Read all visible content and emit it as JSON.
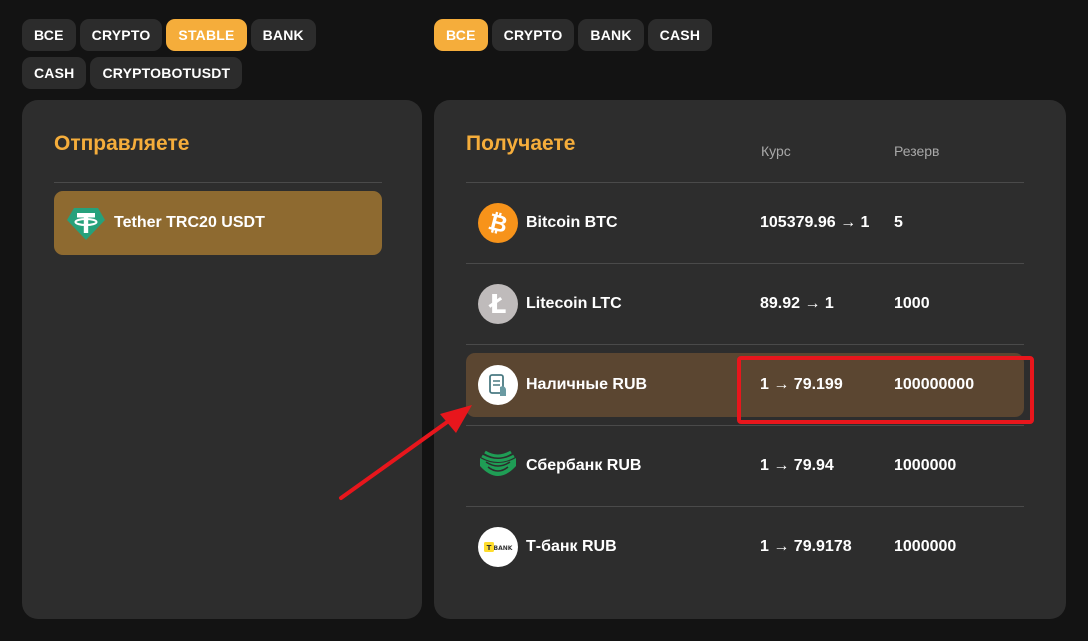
{
  "send_filters": [
    {
      "label": "ВСЕ",
      "active": false
    },
    {
      "label": "CRYPTO",
      "active": false
    },
    {
      "label": "STABLE",
      "active": true
    },
    {
      "label": "BANK",
      "active": false
    },
    {
      "label": "CASH",
      "active": false
    },
    {
      "label": "CRYPTOBOTUSDT",
      "active": false
    }
  ],
  "receive_filters": [
    {
      "label": "ВСЕ",
      "active": true
    },
    {
      "label": "CRYPTO",
      "active": false
    },
    {
      "label": "BANK",
      "active": false
    },
    {
      "label": "CASH",
      "active": false
    }
  ],
  "send": {
    "title": "Отправляете",
    "selected_currency": {
      "name": "Tether TRC20 USDT",
      "icon": "tether-icon"
    }
  },
  "receive": {
    "title": "Получаете",
    "rate_header": "Курс",
    "reserve_header": "Резерв",
    "rows": [
      {
        "name": "Bitcoin BTC",
        "rate": "105379.96 → 1",
        "reserve": "5",
        "icon": "bitcoin-icon"
      },
      {
        "name": "Litecoin LTC",
        "rate": "89.92 → 1",
        "reserve": "1000",
        "icon": "litecoin-icon"
      },
      {
        "name": "Наличные RUB",
        "rate": "1 → 79.199",
        "reserve": "100000000",
        "icon": "cash-icon",
        "selected": true
      },
      {
        "name": "Сбербанк RUB",
        "rate": "1 → 79.94",
        "reserve": "1000000",
        "icon": "sberbank-icon"
      },
      {
        "name": "Т-банк RUB",
        "rate": "1 → 79.9178",
        "reserve": "1000000",
        "icon": "tbank-icon"
      }
    ]
  },
  "tbank_logo_text": "T BANK",
  "colors": {
    "accent": "#f5ad3b",
    "annotation": "#e8161c"
  }
}
